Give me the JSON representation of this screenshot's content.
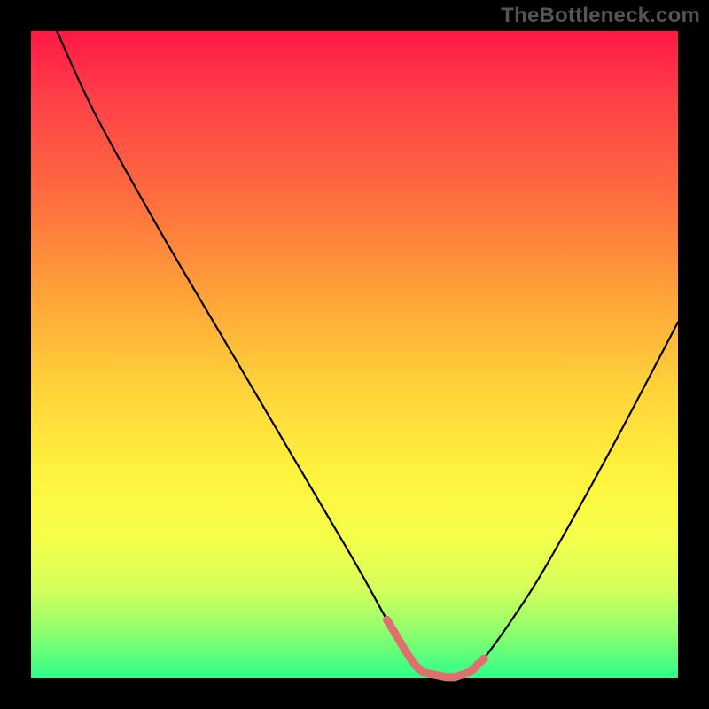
{
  "attribution": "TheBottleneck.com",
  "chart_data": {
    "type": "line",
    "title": "",
    "xlabel": "",
    "ylabel": "",
    "xlim": [
      0,
      100
    ],
    "ylim": [
      0,
      100
    ],
    "series": [
      {
        "name": "bottleneck-curve",
        "x": [
          4,
          10,
          20,
          30,
          40,
          50,
          55,
          58,
          60,
          65,
          68,
          70,
          75,
          80,
          90,
          100
        ],
        "values": [
          100,
          87,
          69,
          52,
          35,
          18,
          9,
          4,
          1,
          0,
          1,
          3,
          10,
          18,
          36,
          55
        ]
      }
    ],
    "highlight_segments": [
      {
        "x_start": 55,
        "x_end": 58
      },
      {
        "x_start": 58,
        "x_end": 68
      },
      {
        "x_start": 68,
        "x_end": 70
      }
    ],
    "gradient_stops": [
      {
        "pos": 0,
        "color": "#ff1844"
      },
      {
        "pos": 25,
        "color": "#ff6a3f"
      },
      {
        "pos": 55,
        "color": "#ffd23a"
      },
      {
        "pos": 78,
        "color": "#f6ff4a"
      },
      {
        "pos": 100,
        "color": "#2cff88"
      }
    ]
  }
}
